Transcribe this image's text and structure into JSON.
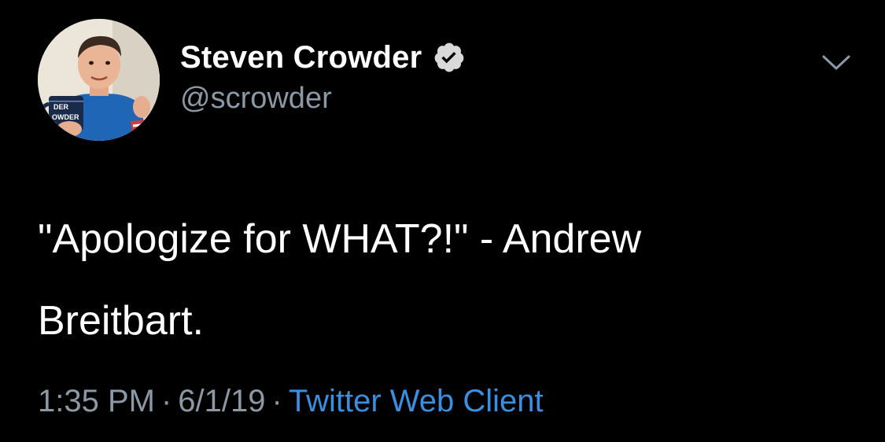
{
  "author": {
    "display_name": "Steven Crowder",
    "handle": "@scrowder",
    "verified": true,
    "avatar_mug_text_1": "DER",
    "avatar_mug_text_2": "OWDER"
  },
  "tweet": {
    "text_line_1": "\"Apologize for WHAT?!\" - Andrew",
    "text_line_2": "Breitbart."
  },
  "meta": {
    "time": "1:35 PM",
    "date": "6/1/19",
    "separator": "·",
    "source": "Twitter Web Client"
  },
  "icons": {
    "verified": "verified-badge-icon",
    "menu": "chevron-down-icon"
  },
  "colors": {
    "background": "#000000",
    "text": "#ffffff",
    "secondary": "#8b98a5",
    "link": "#3a8fe0"
  }
}
